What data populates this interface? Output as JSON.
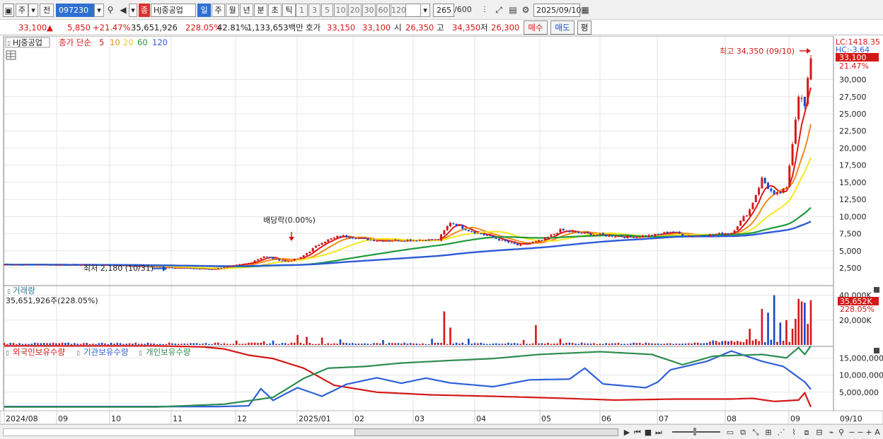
{
  "toolbar": {
    "type_select": "주",
    "prev_label": "전",
    "code_value": "097230",
    "stock_tag": "종",
    "stock_name": "HJ중공업",
    "periods": [
      "일",
      "주",
      "월",
      "년",
      "분",
      "초",
      "틱"
    ],
    "active_period": "일",
    "intervals": [
      "1",
      "3",
      "5",
      "10",
      "20",
      "30",
      "60",
      "120"
    ],
    "count_value": "265",
    "count_total": "/600",
    "date_value": "2025/09/10"
  },
  "info": {
    "price": "33,100",
    "change": "5,850",
    "change_pct": "+21.47%",
    "volume": "35,651,926",
    "volume_pct": "228.05%",
    "turnover_pct": "42.81%",
    "amount": "1,133,653백만",
    "quote_label": "호가",
    "ask": "33,150",
    "bid": "33,100",
    "open_label": "시",
    "open": "26,350",
    "high_label": "고",
    "high": "34,350",
    "low_label": "저",
    "low": "26,300",
    "buy_label": "매수",
    "sell_label": "매도",
    "avg_label": "평"
  },
  "colors": {
    "up": "#d41818",
    "down": "#1848c8",
    "ma5": "#e01818",
    "ma10": "#f08a1c",
    "ma20": "#f5e81e",
    "ma60": "#1e9a3c",
    "ma120": "#2e5bd8",
    "foreign": "#d41818",
    "institution": "#3060d8",
    "individual": "#2e8c50"
  },
  "price_panel": {
    "name_tag": "HJ중공업",
    "legend_label": "종가 단순",
    "ma_labels": [
      "5",
      "10",
      "20",
      "60",
      "120"
    ],
    "lc_label": "LC:1418.35",
    "hc_label": "HC:-3.64",
    "current_label": "33,100",
    "pct_label": "21.47%",
    "high_annotation": "최고 34,350 (09/10)",
    "low_annotation": "최저 2,180 (10/31)",
    "dividend_annotation": "배당락(0.00%)"
  },
  "volume_panel": {
    "title": "거래량",
    "value_label": "35,651,926주(228.05%)",
    "current_label": "35,652K",
    "pct_label": "228.05%"
  },
  "holdings_panel": {
    "legend": [
      "외국인보유수량",
      "기관보유수량",
      "개인보유수량"
    ]
  },
  "bottom_bar": {
    "x_labels": [
      "2024/08",
      "09",
      "10",
      "11",
      "12",
      "2025/01",
      "02",
      "03",
      "04",
      "05",
      "06",
      "07",
      "08",
      "09"
    ],
    "right_label": "09/10"
  },
  "chart_data": [
    {
      "type": "candlestick",
      "title": "HJ중공업",
      "x_start": "2024/08",
      "x_end": "2025/09/10",
      "ylim": [
        0,
        36000
      ],
      "y_ticks": [
        2500,
        5000,
        7500,
        10000,
        12500,
        15000,
        17500,
        20000,
        22500,
        25000,
        27500,
        30000
      ],
      "y_tick_labels": [
        "2,500",
        "5,000",
        "7,500",
        "10,000",
        "12,500",
        "15,000",
        "17,500",
        "20,000",
        "22,500",
        "25,000",
        "27,500",
        "30,000"
      ],
      "close_anchors": [
        [
          0,
          3000
        ],
        [
          35,
          2900
        ],
        [
          63,
          2400
        ],
        [
          68,
          2300
        ],
        [
          80,
          3200
        ],
        [
          85,
          4200
        ],
        [
          92,
          3400
        ],
        [
          97,
          4000
        ],
        [
          104,
          6300
        ],
        [
          110,
          7200
        ],
        [
          122,
          6500
        ],
        [
          136,
          6600
        ],
        [
          142,
          6600
        ],
        [
          146,
          9200
        ],
        [
          152,
          8000
        ],
        [
          168,
          5800
        ],
        [
          176,
          6500
        ],
        [
          182,
          8000
        ],
        [
          188,
          7600
        ],
        [
          196,
          7300
        ],
        [
          205,
          7000
        ],
        [
          213,
          7300
        ],
        [
          218,
          7800
        ],
        [
          225,
          7100
        ],
        [
          238,
          7600
        ],
        [
          244,
          11000
        ],
        [
          248,
          15500
        ],
        [
          252,
          13000
        ],
        [
          256,
          14000
        ],
        [
          260,
          28000
        ],
        [
          262,
          26000
        ],
        [
          264,
          33100
        ]
      ],
      "series": [
        {
          "name": "5",
          "period": 5
        },
        {
          "name": "10",
          "period": 10
        },
        {
          "name": "20",
          "period": 20
        },
        {
          "name": "60",
          "period": 60
        },
        {
          "name": "120",
          "period": 120
        }
      ],
      "high": 34350,
      "low": 2180
    },
    {
      "type": "bar",
      "title": "거래량",
      "y_ticks": [
        20000,
        40000
      ],
      "y_tick_labels": [
        "20,000K",
        "40,000K"
      ],
      "spikes": [
        [
          76,
          3500
        ],
        [
          85,
          3000
        ],
        [
          88,
          3500
        ],
        [
          96,
          8000
        ],
        [
          99,
          6500
        ],
        [
          104,
          6000
        ],
        [
          110,
          4500
        ],
        [
          124,
          4000
        ],
        [
          140,
          5000
        ],
        [
          144,
          27000
        ],
        [
          146,
          14000
        ],
        [
          152,
          5000
        ],
        [
          170,
          4000
        ],
        [
          174,
          16000
        ],
        [
          182,
          5000
        ],
        [
          244,
          13000
        ],
        [
          248,
          29000
        ],
        [
          250,
          26000
        ],
        [
          252,
          40000
        ],
        [
          254,
          18000
        ],
        [
          256,
          20000
        ],
        [
          258,
          13000
        ],
        [
          259,
          21000
        ],
        [
          260,
          37000
        ],
        [
          261,
          35000
        ],
        [
          262,
          34000
        ],
        [
          263,
          17000
        ],
        [
          264,
          36000
        ]
      ],
      "base_volume": 1400
    },
    {
      "type": "line",
      "title": "보유수량",
      "y_ticks": [
        5000000,
        10000000,
        15000000
      ],
      "y_tick_labels": [
        "5,000,000",
        "10,000,000",
        "15,000,000"
      ],
      "series": [
        {
          "name": "외국인보유수량",
          "anchors": [
            [
              0,
              18500000
            ],
            [
              50,
              18500000
            ],
            [
              65,
              18200000
            ],
            [
              72,
              17600000
            ],
            [
              80,
              15800000
            ],
            [
              88,
              14800000
            ],
            [
              98,
              12000000
            ],
            [
              108,
              7000000
            ],
            [
              122,
              5000000
            ],
            [
              140,
              4200000
            ],
            [
              160,
              3800000
            ],
            [
              180,
              3300000
            ],
            [
              200,
              2700000
            ],
            [
              220,
              3000000
            ],
            [
              238,
              3000000
            ],
            [
              245,
              3200000
            ],
            [
              252,
              2300000
            ],
            [
              260,
              2700000
            ],
            [
              262,
              4800000
            ],
            [
              264,
              700000
            ]
          ]
        },
        {
          "name": "기관보유수량",
          "anchors": [
            [
              0,
              800000
            ],
            [
              70,
              800000
            ],
            [
              80,
              1000000
            ],
            [
              84,
              6000000
            ],
            [
              88,
              2600000
            ],
            [
              92,
              4500000
            ],
            [
              96,
              6300000
            ],
            [
              104,
              3800000
            ],
            [
              112,
              7300000
            ],
            [
              122,
              9200000
            ],
            [
              130,
              7600000
            ],
            [
              138,
              9100000
            ],
            [
              146,
              7700000
            ],
            [
              160,
              6600000
            ],
            [
              172,
              8600000
            ],
            [
              185,
              8800000
            ],
            [
              190,
              12000000
            ],
            [
              196,
              7400000
            ],
            [
              210,
              6300000
            ],
            [
              214,
              8000000
            ],
            [
              218,
              11500000
            ],
            [
              230,
              14000000
            ],
            [
              238,
              17000000
            ],
            [
              248,
              14000000
            ],
            [
              255,
              12500000
            ],
            [
              262,
              8000000
            ],
            [
              264,
              5800000
            ]
          ]
        },
        {
          "name": "개인보유수량",
          "anchors": [
            [
              0,
              700000
            ],
            [
              50,
              700000
            ],
            [
              72,
              1500000
            ],
            [
              88,
              3500000
            ],
            [
              98,
              9000000
            ],
            [
              106,
              12000000
            ],
            [
              118,
              12500000
            ],
            [
              130,
              13500000
            ],
            [
              145,
              14200000
            ],
            [
              160,
              14800000
            ],
            [
              175,
              16000000
            ],
            [
              195,
              16800000
            ],
            [
              212,
              16000000
            ],
            [
              222,
              13000000
            ],
            [
              232,
              15500000
            ],
            [
              248,
              16000000
            ],
            [
              256,
              15000000
            ],
            [
              260,
              18000000
            ],
            [
              262,
              16000000
            ],
            [
              264,
              18500000
            ]
          ]
        }
      ]
    }
  ]
}
